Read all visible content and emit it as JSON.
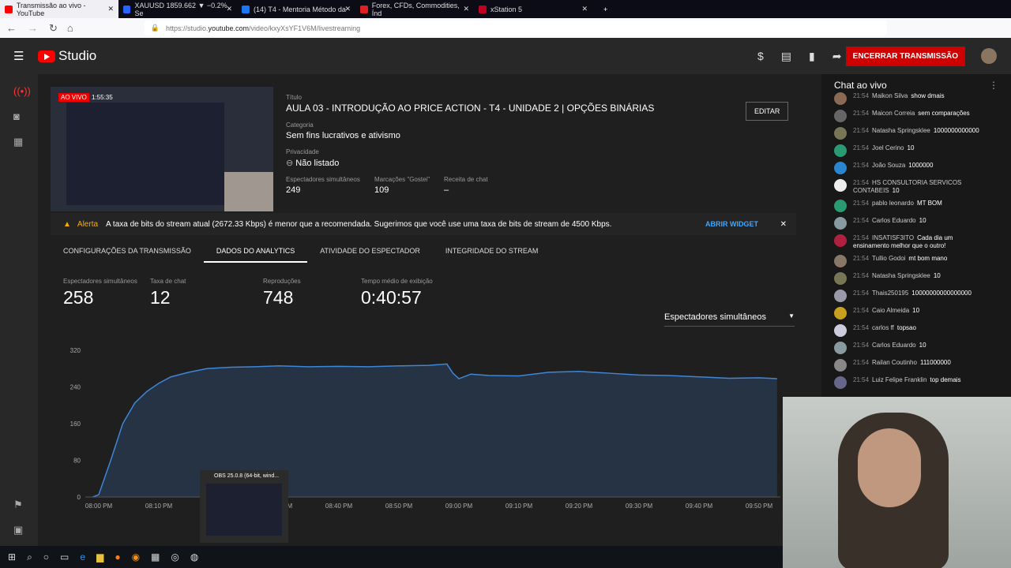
{
  "browser": {
    "tabs": [
      {
        "title": "Transmissão ao vivo - YouTube",
        "color": "#ff0000",
        "active": true
      },
      {
        "title": "XAUUSD 1859.662 ▼ −0.2% Se",
        "color": "#2962ff"
      },
      {
        "title": "(14) T4 - Mentoria Método da",
        "color": "#1877f2"
      },
      {
        "title": "Forex, CFDs, Commodities, Índ",
        "color": "#e02020"
      },
      {
        "title": "xStation 5",
        "color": "#c00020"
      }
    ],
    "url_prefix": "https://studio.",
    "url_domain": "youtube.com",
    "url_path": "/video/kxyXsYF1V6M/livestreaming"
  },
  "header": {
    "logo": "Studio",
    "end_button": "ENCERRAR TRANSMISSÃO"
  },
  "stream": {
    "live_badge": "AO VIVO",
    "elapsed": "1:55:35",
    "title_label": "Título",
    "title": "AULA 03 - INTRODUÇÃO AO PRICE ACTION - T4 - UNIDADE 2 | OPÇÕES BINÁRIAS",
    "category_label": "Categoria",
    "category": "Sem fins lucrativos e ativismo",
    "privacy_label": "Privacidade",
    "privacy": "Não listado",
    "viewers_label": "Espectadores simultâneos",
    "viewers": "249",
    "likes_label": "Marcações \"Gostei\"",
    "likes": "109",
    "revenue_label": "Receita de chat",
    "revenue": "–",
    "edit_button": "EDITAR"
  },
  "alert": {
    "label": "Alerta",
    "text": "A taxa de bits do stream atual (2672.33 Kbps) é menor que a recomendada. Sugerimos que você use uma taxa de bits de stream de 4500 Kbps.",
    "action": "ABRIR WIDGET"
  },
  "tabs": [
    "CONFIGURAÇÕES DA TRANSMISSÃO",
    "DADOS DO ANALYTICS",
    "ATIVIDADE DO ESPECTADOR",
    "INTEGRIDADE DO STREAM"
  ],
  "metrics": [
    {
      "label": "Espectadores simultâneos",
      "value": "258"
    },
    {
      "label": "Taxa de chat",
      "value": "12"
    },
    {
      "label": "Reproduções",
      "value": "748"
    },
    {
      "label": "Tempo médio de exibição",
      "value": "0:40:57"
    }
  ],
  "dropdown": "Espectadores simultâneos",
  "chart_data": {
    "type": "area",
    "ylim": [
      0,
      320
    ],
    "yticks": [
      "320",
      "240",
      "160",
      "80",
      "0"
    ],
    "xticks": [
      "08:00 PM",
      "08:10 PM",
      "08:20 PM",
      "08:30 PM",
      "08:40 PM",
      "08:50 PM",
      "09:00 PM",
      "09:10 PM",
      "09:20 PM",
      "09:30 PM",
      "09:40 PM",
      "09:50 PM"
    ],
    "x_minutes": [
      -1,
      0,
      2,
      4,
      6,
      8,
      10,
      12,
      15,
      18,
      22,
      26,
      30,
      35,
      40,
      45,
      50,
      55,
      58,
      59,
      60,
      62,
      65,
      70,
      75,
      80,
      85,
      90,
      95,
      100,
      105,
      110,
      113
    ],
    "values": [
      0,
      5,
      80,
      160,
      205,
      230,
      248,
      262,
      272,
      280,
      283,
      284,
      286,
      284,
      285,
      284,
      286,
      287,
      290,
      270,
      258,
      268,
      265,
      264,
      272,
      274,
      270,
      266,
      265,
      262,
      259,
      260,
      258
    ]
  },
  "chat": {
    "title": "Chat ao vivo",
    "messages": [
      {
        "time": "21:54",
        "author": "Maikon Silva",
        "text": "show dmais",
        "color": "#8a6a55"
      },
      {
        "time": "21:54",
        "author": "Maicon Correia",
        "text": "sem comparações",
        "color": "#666"
      },
      {
        "time": "21:54",
        "author": "Natasha Springsklee",
        "text": "1000000000000",
        "color": "#775"
      },
      {
        "time": "21:54",
        "author": "Joel Cerino",
        "text": "10",
        "color": "#2a9a72"
      },
      {
        "time": "21:54",
        "author": "João Souza",
        "text": "1000000",
        "color": "#2b86d0"
      },
      {
        "time": "21:54",
        "author": "HS CONSULTORIA SERVICOS CONTABEIS",
        "text": "10",
        "color": "#eee"
      },
      {
        "time": "21:54",
        "author": "pablo leonardo",
        "text": "MT BOM",
        "color": "#2a9a72"
      },
      {
        "time": "21:54",
        "author": "Carlos Eduardo",
        "text": "10",
        "color": "#8899a0"
      },
      {
        "time": "21:54",
        "author": "INSATISF3ITO",
        "text": "Cada dia um ensinamento melhor que o outro!",
        "color": "#b02040"
      },
      {
        "time": "21:54",
        "author": "Tullio Godoi",
        "text": "mt bom mano",
        "color": "#876"
      },
      {
        "time": "21:54",
        "author": "Natasha Springsklee",
        "text": "10",
        "color": "#775"
      },
      {
        "time": "21:54",
        "author": "Thais250195",
        "text": "10000000000000000",
        "color": "#99a"
      },
      {
        "time": "21:54",
        "author": "Caio Almeida",
        "text": "10",
        "color": "#c8a020"
      },
      {
        "time": "21:54",
        "author": "carlos ff",
        "text": "topsao",
        "color": "#ccd"
      },
      {
        "time": "21:54",
        "author": "Carlos Eduardo",
        "text": "10",
        "color": "#8899a0"
      },
      {
        "time": "21:54",
        "author": "Railan Coutinho",
        "text": "111000000",
        "color": "#888"
      },
      {
        "time": "21:54",
        "author": "Luiz Felipe Franklin",
        "text": "top demais",
        "color": "#668"
      }
    ]
  },
  "taskbar": {
    "popup": "OBS 25.0.8 (64-bit, wind..."
  }
}
